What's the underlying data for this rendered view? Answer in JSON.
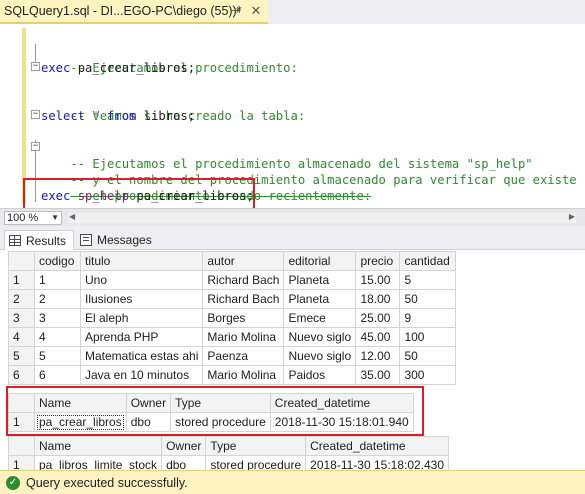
{
  "tab": {
    "title": "SQLQuery1.sql - DI...EGO-PC\\diego (55))*",
    "pin_glyph": "⇥",
    "close_glyph": "✕"
  },
  "editor": {
    "lines": [
      {
        "comment": "-- Ejecutamos el procedimiento:"
      },
      {
        "kw": "exec",
        "rest": " pa_crear_libros;"
      },
      {
        "comment": "-- Veamos si ha creado la tabla:"
      },
      {
        "kw": "select",
        "star": " * ",
        "kw2": "from",
        "rest": " libros;"
      },
      {
        "comment": "-- Ejecutamos el procedimiento almacenado del sistema \"sp_help\""
      },
      {
        "comment": "-- y el nombre del procedimiento almacenado para verificar que existe"
      },
      {
        "comment": "   el procedimiento creado recientemente:"
      },
      {
        "kw": "exec",
        "proc": " sp_help",
        "rest": " pa_crear_libros;"
      }
    ]
  },
  "zoom": {
    "value": "100 %"
  },
  "result_tabs": {
    "results": "Results",
    "messages": "Messages"
  },
  "grid1": {
    "columns": [
      "codigo",
      "titulo",
      "autor",
      "editorial",
      "precio",
      "cantidad"
    ],
    "rows": [
      [
        "1",
        "1",
        "Uno",
        "Richard Bach",
        "Planeta",
        "15.00",
        "5"
      ],
      [
        "2",
        "2",
        "Ilusiones",
        "Richard Bach",
        "Planeta",
        "18.00",
        "50"
      ],
      [
        "3",
        "3",
        "El aleph",
        "Borges",
        "Emece",
        "25.00",
        "9"
      ],
      [
        "4",
        "4",
        "Aprenda PHP",
        "Mario Molina",
        "Nuevo siglo",
        "45.00",
        "100"
      ],
      [
        "5",
        "5",
        "Matematica estas ahi",
        "Paenza",
        "Nuevo siglo",
        "12.00",
        "50"
      ],
      [
        "6",
        "6",
        "Java en 10 minutos",
        "Mario Molina",
        "Paidos",
        "35.00",
        "300"
      ]
    ]
  },
  "grid2": {
    "columns": [
      "Name",
      "Owner",
      "Type",
      "Created_datetime"
    ],
    "rows": [
      [
        "1",
        "pa_crear_libros",
        "dbo",
        "stored procedure",
        "2018-11-30 15:18:01.940"
      ]
    ]
  },
  "grid3": {
    "columns": [
      "Name",
      "Owner",
      "Type",
      "Created_datetime"
    ],
    "rows": [
      [
        "1",
        "pa_libros_limite_stock",
        "dbo",
        "stored procedure",
        "2018-11-30 15:18:02.430"
      ]
    ]
  },
  "status": {
    "text": "Query executed successfully.",
    "icon": "check-circle-icon"
  },
  "colors": {
    "highlight_box": "#d8202a",
    "comment": "#2e8b2e",
    "keyword": "#1515d6",
    "status_bar": "#fef3c0"
  }
}
